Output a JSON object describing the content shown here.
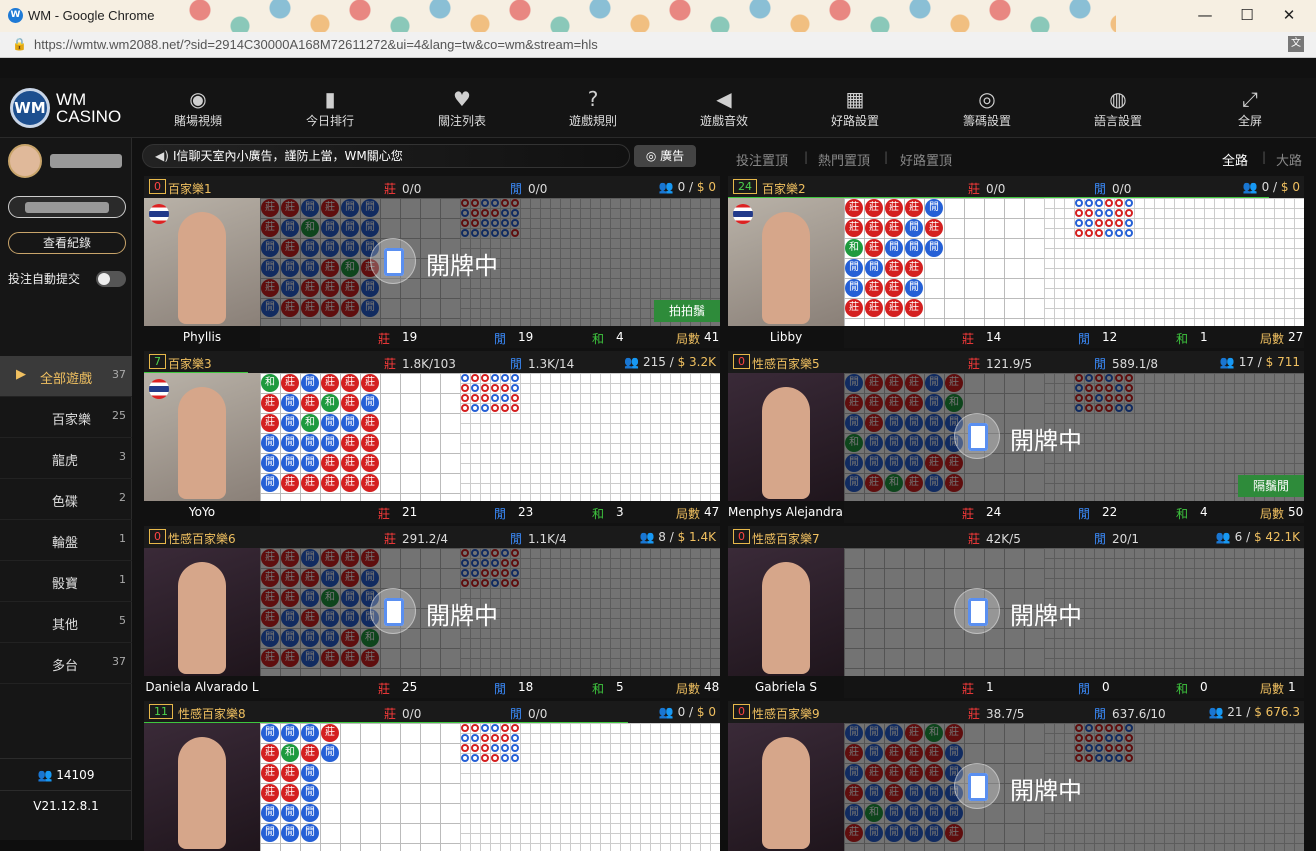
{
  "browser": {
    "title": "WM - Google Chrome",
    "url": "https://wmtw.wm2088.net/?sid=2914C30000A168M72611272&ui=4&lang=tw&co=wm&stream=hls",
    "min_label": "—",
    "max_label": "☐",
    "close_label": "✕"
  },
  "logo": {
    "mark": "WM",
    "line1": "WM",
    "line2": "CASINO"
  },
  "nav": [
    {
      "label": "賭場視頻",
      "icon": "webcam-icon",
      "glyph": "◉"
    },
    {
      "label": "今日排行",
      "icon": "bar-chart-icon",
      "glyph": "▮"
    },
    {
      "label": "關注列表",
      "icon": "heart-icon",
      "glyph": "♥"
    },
    {
      "label": "遊戲規則",
      "icon": "question-icon",
      "glyph": "?"
    },
    {
      "label": "遊戲音效",
      "icon": "speaker-icon",
      "glyph": "◀"
    },
    {
      "label": "好路設置",
      "icon": "grid-icon",
      "glyph": "▦"
    },
    {
      "label": "籌碼設置",
      "icon": "chip-icon",
      "glyph": "◎"
    },
    {
      "label": "語言設置",
      "icon": "globe-icon",
      "glyph": "◍"
    },
    {
      "label": "全屏",
      "icon": "fullscreen-icon",
      "glyph": "⤢"
    }
  ],
  "sidebar": {
    "history_label": "查看紀錄",
    "autobet_label": "投注自動提交",
    "categories": [
      {
        "label": "全部遊戲",
        "count": "37"
      },
      {
        "label": "百家樂",
        "count": "25"
      },
      {
        "label": "龍虎",
        "count": "3"
      },
      {
        "label": "色碟",
        "count": "2"
      },
      {
        "label": "輪盤",
        "count": "1"
      },
      {
        "label": "骰寶",
        "count": "1"
      },
      {
        "label": "其他",
        "count": "5"
      },
      {
        "label": "多台",
        "count": "37"
      }
    ],
    "online": "14109",
    "version": "V21.12.8.1"
  },
  "marquee": {
    "text": "I信聊天室內小廣告，謹防上當，WM關心您",
    "ad_label": "廣告"
  },
  "toptabs": [
    "投注置頂",
    "熱門置頂",
    "好路置頂"
  ],
  "viewtabs": [
    "全路",
    "大路"
  ],
  "labels": {
    "banker": "莊",
    "player": "閒",
    "tie": "和",
    "rounds": "局數",
    "dealing": "開牌中"
  },
  "rooms": [
    {
      "num": "0",
      "name": "百家樂1",
      "banker_bet": "0/0",
      "player_bet": "0/0",
      "people": "0",
      "money": "$ 0",
      "dealer": "Phyllis",
      "b": "19",
      "p": "19",
      "t": "4",
      "rounds": "41",
      "dealing": true,
      "tag": "拍拍鬚",
      "progress": 0
    },
    {
      "num": "24",
      "name": "百家樂2",
      "banker_bet": "0/0",
      "player_bet": "0/0",
      "people": "0",
      "money": "$ 0",
      "dealer": "Libby",
      "b": "14",
      "p": "12",
      "t": "1",
      "rounds": "27",
      "dealing": false,
      "tag": "",
      "progress": 0.94
    },
    {
      "num": "7",
      "name": "百家樂3",
      "banker_bet": "1.8K/103",
      "player_bet": "1.3K/14",
      "people": "215",
      "money": "$ 3.2K",
      "dealer": "YoYo",
      "b": "21",
      "p": "23",
      "t": "3",
      "rounds": "47",
      "dealing": false,
      "tag": "",
      "progress": 0.18
    },
    {
      "num": "0",
      "name": "性感百家樂5",
      "banker_bet": "121.9/5",
      "player_bet": "589.1/8",
      "people": "17",
      "money": "$ 711",
      "dealer": "Menphys Alejandra J",
      "b": "24",
      "p": "22",
      "t": "4",
      "rounds": "50",
      "dealing": true,
      "tag": "隔鬚閒",
      "progress": 0
    },
    {
      "num": "0",
      "name": "性感百家樂6",
      "banker_bet": "291.2/4",
      "player_bet": "1.1K/4",
      "people": "8",
      "money": "$ 1.4K",
      "dealer": "Daniela Alvarado L",
      "b": "25",
      "p": "18",
      "t": "5",
      "rounds": "48",
      "dealing": true,
      "tag": "",
      "progress": 0
    },
    {
      "num": "0",
      "name": "性感百家樂7",
      "banker_bet": "42K/5",
      "player_bet": "20/1",
      "people": "6",
      "money": "$ 42.1K",
      "dealer": "Gabriela S",
      "b": "1",
      "p": "0",
      "t": "0",
      "rounds": "1",
      "dealing": true,
      "tag": "",
      "progress": 0
    },
    {
      "num": "11",
      "name": "性感百家樂8",
      "banker_bet": "0/0",
      "player_bet": "0/0",
      "people": "0",
      "money": "$ 0",
      "dealer": "",
      "b": "",
      "p": "",
      "t": "",
      "rounds": "",
      "dealing": false,
      "tag": "",
      "progress": 0.84
    },
    {
      "num": "0",
      "name": "性感百家樂9",
      "banker_bet": "38.7/5",
      "player_bet": "637.6/10",
      "people": "21",
      "money": "$ 676.3",
      "dealer": "",
      "b": "",
      "p": "",
      "t": "",
      "rounds": "",
      "dealing": true,
      "tag": "",
      "progress": 0
    }
  ]
}
